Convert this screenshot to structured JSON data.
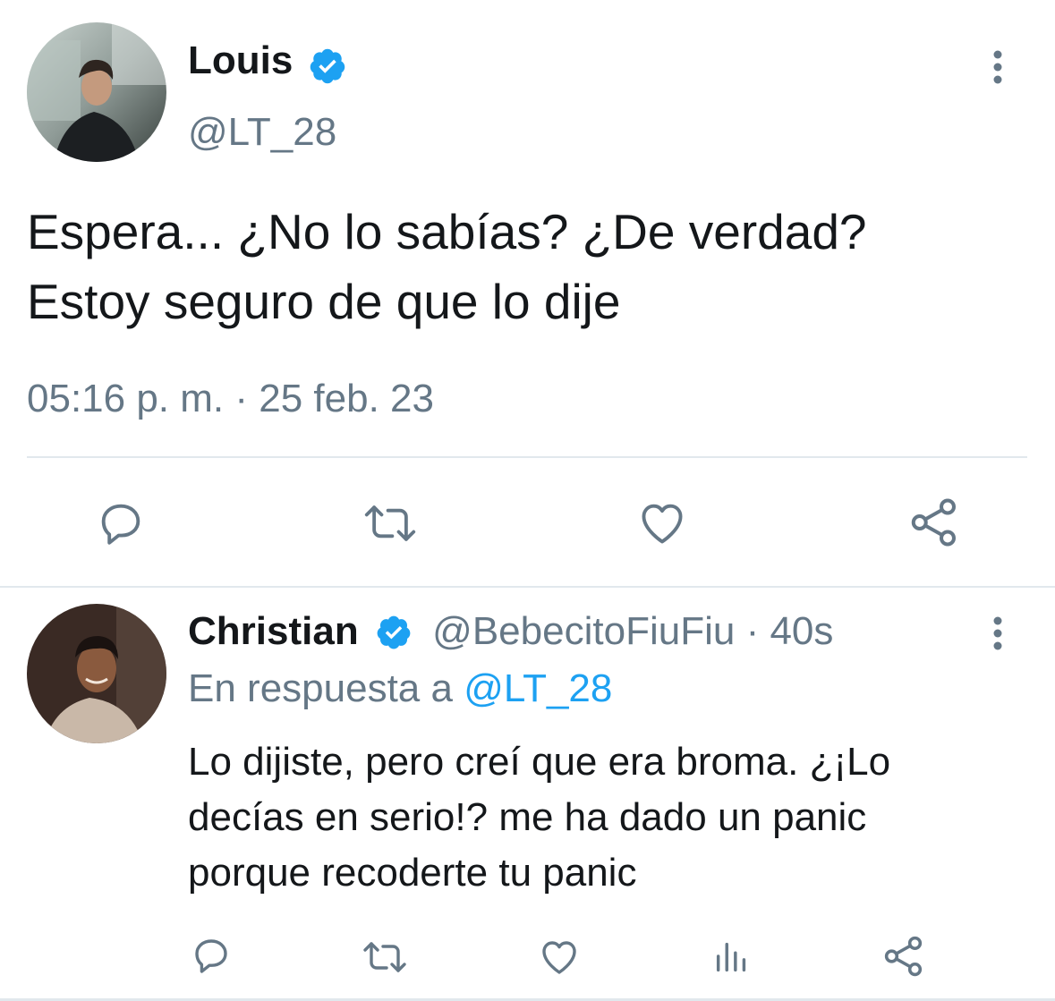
{
  "main_tweet": {
    "display_name": "Louis",
    "handle": "@LT_28",
    "text_line1": "Espera... ¿No lo sabías? ¿De verdad?",
    "text_line2": "Estoy seguro de que lo dije",
    "timestamp": "05:16 p. m. · 25 feb. 23",
    "actions": [
      "reply-icon",
      "retweet-icon",
      "like-icon",
      "share-icon"
    ]
  },
  "reply_tweet": {
    "display_name": "Christian",
    "handle": "@BebecitoFiuFiu",
    "separator": "·",
    "time_ago": "40s",
    "in_reply_prefix": "En respuesta a",
    "in_reply_handle": "@LT_28",
    "text_line1": "Lo dijiste, pero creí que era broma. ¿¡Lo",
    "text_line2": "decías en serio!? me ha dado un panic",
    "text_line3": "porque recoderte tu panic",
    "actions": [
      "reply-icon",
      "retweet-icon",
      "like-icon",
      "analytics-icon",
      "share-icon"
    ]
  },
  "colors": {
    "accent": "#1da1f2",
    "muted_text": "#657786",
    "primary_text": "#14171a",
    "divider": "#e1e8ed"
  }
}
